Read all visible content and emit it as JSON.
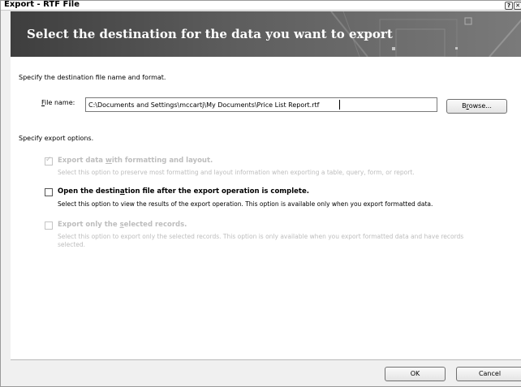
{
  "window": {
    "title": "Export - RTF File",
    "help_glyph": "?",
    "close_glyph": "✕"
  },
  "banner": {
    "heading": "Select the destination for the data you want to export"
  },
  "destination": {
    "instruction": "Specify the destination file name and format.",
    "file_name_label_accel": "F",
    "file_name_label_rest": "ile name:",
    "file_name_value": "C:\\Documents and Settings\\mccartj\\My Documents\\Price List Report.rtf",
    "browse_label_pre": "B",
    "browse_label_accel": "r",
    "browse_label_post": "owse..."
  },
  "export_options": {
    "instruction": "Specify export options.",
    "options": [
      {
        "title_pre": "Export data ",
        "title_accel": "w",
        "title_post": "ith formatting and layout.",
        "description": "Select this option to preserve most formatting and layout information when exporting a table, query, form, or report.",
        "checked": true,
        "enabled": false
      },
      {
        "title_pre": "Open the destin",
        "title_accel": "a",
        "title_post": "tion file after the export operation is complete.",
        "description": "Select this option to view the results of the export operation. This option is available only when you export formatted data.",
        "checked": false,
        "enabled": true
      },
      {
        "title_pre": "Export only the ",
        "title_accel": "s",
        "title_post": "elected records.",
        "description_line1": "Select this option to export only the selected records. This option is only available when you export formatted data and have records",
        "description_line2": "selected.",
        "checked": false,
        "enabled": false
      }
    ]
  },
  "footer": {
    "ok_label": "OK",
    "cancel_label": "Cancel"
  },
  "colors": {
    "banner_dark": "#3e3e3e",
    "banner_light": "#7a7a7a",
    "disabled_text": "#bdbdbd"
  },
  "icons": {
    "help": "help-icon",
    "close": "close-icon",
    "checkmark": "checkmark-icon"
  }
}
